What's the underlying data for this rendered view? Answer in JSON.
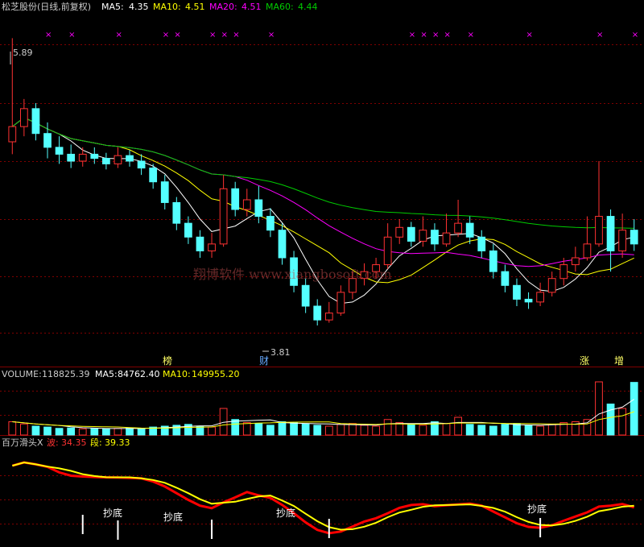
{
  "header": {
    "title": "松芝股份(日线,前复权)",
    "ma5_label": "MA5:",
    "ma5_value": "4.35",
    "ma10_label": "MA10:",
    "ma10_value": "4.51",
    "ma20_label": "MA20:",
    "ma20_value": "4.51",
    "ma60_label": "MA60:",
    "ma60_value": "4.44"
  },
  "price_panel": {
    "high_label": "5.89",
    "low_label": "3.81",
    "watermark": "翔博软件 www.xiangbosoft.com",
    "markers": [
      "榜",
      "财",
      "涨",
      "增"
    ]
  },
  "volume_panel": {
    "volume_label": "VOLUME:",
    "volume_value": "118825.39",
    "ma5_label": "MA5:",
    "ma5_value": "84762.40",
    "ma10_label": "MA10:",
    "ma10_value": "149955.20"
  },
  "indicator_panel": {
    "name": "百万滑头X",
    "wave_label": "波:",
    "wave_value": "34.35",
    "segment_label": "段:",
    "segment_value": "39.33",
    "signal_text": "抄底"
  },
  "colors": {
    "up": "#ff3232",
    "down": "#54ffff",
    "ma5": "#ffffff",
    "ma10": "#ffff00",
    "ma20": "#ff00ff",
    "ma60": "#00cc00",
    "grid": "#800000",
    "wave": "#ff0000",
    "segment": "#ffff00"
  },
  "chart_data": [
    {
      "type": "candlestick",
      "title": "松芝股份(日线,前复权)",
      "y_range": [
        3.81,
        5.89
      ],
      "series": [
        {
          "name": "MA5",
          "last": 4.35
        },
        {
          "name": "MA10",
          "last": 4.51
        },
        {
          "name": "MA20",
          "last": 4.51
        },
        {
          "name": "MA60",
          "last": 4.44
        }
      ],
      "candles": [
        [
          5.14,
          5.25,
          5.89,
          5.05
        ],
        [
          5.25,
          5.38,
          5.45,
          5.18
        ],
        [
          5.38,
          5.2,
          5.42,
          5.15
        ],
        [
          5.2,
          5.1,
          5.28,
          5.02
        ],
        [
          5.1,
          5.05,
          5.18,
          4.98
        ],
        [
          5.05,
          5.0,
          5.12,
          4.95
        ],
        [
          5.0,
          5.05,
          5.1,
          4.96
        ],
        [
          5.05,
          5.02,
          5.1,
          4.98
        ],
        [
          5.02,
          4.98,
          5.06,
          4.94
        ],
        [
          4.98,
          5.04,
          5.1,
          4.95
        ],
        [
          5.04,
          5.0,
          5.08,
          4.96
        ],
        [
          5.0,
          4.95,
          5.05,
          4.9
        ],
        [
          4.95,
          4.85,
          4.98,
          4.8
        ],
        [
          4.85,
          4.7,
          4.9,
          4.65
        ],
        [
          4.7,
          4.55,
          4.74,
          4.5
        ],
        [
          4.55,
          4.45,
          4.6,
          4.4
        ],
        [
          4.45,
          4.35,
          4.5,
          4.3
        ],
        [
          4.35,
          4.4,
          4.48,
          4.3
        ],
        [
          4.4,
          4.8,
          4.9,
          4.38
        ],
        [
          4.8,
          4.65,
          4.85,
          4.6
        ],
        [
          4.65,
          4.72,
          4.8,
          4.6
        ],
        [
          4.72,
          4.6,
          4.82,
          4.55
        ],
        [
          4.6,
          4.5,
          4.66,
          4.45
        ],
        [
          4.5,
          4.3,
          4.55,
          4.25
        ],
        [
          4.3,
          4.1,
          4.35,
          4.05
        ],
        [
          4.1,
          3.95,
          4.15,
          3.9
        ],
        [
          3.95,
          3.85,
          4.0,
          3.81
        ],
        [
          3.85,
          3.9,
          3.98,
          3.83
        ],
        [
          3.9,
          4.05,
          4.1,
          3.88
        ],
        [
          4.05,
          4.15,
          4.2,
          4.0
        ],
        [
          4.15,
          4.2,
          4.26,
          4.1
        ],
        [
          4.2,
          4.25,
          4.3,
          4.15
        ],
        [
          4.25,
          4.45,
          4.55,
          4.22
        ],
        [
          4.45,
          4.52,
          4.58,
          4.4
        ],
        [
          4.52,
          4.42,
          4.56,
          4.38
        ],
        [
          4.42,
          4.5,
          4.6,
          4.38
        ],
        [
          4.5,
          4.4,
          4.55,
          4.35
        ],
        [
          4.4,
          4.48,
          4.62,
          4.38
        ],
        [
          4.48,
          4.55,
          4.72,
          4.45
        ],
        [
          4.55,
          4.45,
          4.6,
          4.4
        ],
        [
          4.45,
          4.35,
          4.5,
          4.3
        ],
        [
          4.35,
          4.2,
          4.4,
          4.15
        ],
        [
          4.2,
          4.1,
          4.25,
          4.05
        ],
        [
          4.1,
          4.0,
          4.15,
          3.95
        ],
        [
          4.0,
          3.98,
          4.05,
          3.93
        ],
        [
          3.98,
          4.05,
          4.12,
          3.95
        ],
        [
          4.05,
          4.15,
          4.2,
          4.02
        ],
        [
          4.15,
          4.25,
          4.3,
          4.1
        ],
        [
          4.25,
          4.3,
          4.38,
          4.2
        ],
        [
          4.3,
          4.4,
          4.6,
          4.28
        ],
        [
          4.4,
          4.6,
          5.0,
          4.38
        ],
        [
          4.6,
          4.35,
          4.65,
          4.2
        ],
        [
          4.35,
          4.5,
          4.62,
          4.3
        ],
        [
          4.5,
          4.4,
          4.58,
          4.35
        ]
      ]
    },
    {
      "type": "bar",
      "title": "VOLUME",
      "series": [
        {
          "name": "VOLUME",
          "last": 118825.39
        },
        {
          "name": "MA5",
          "last": 84762.4
        },
        {
          "name": "MA10",
          "last": 149955.2
        }
      ],
      "values": [
        30,
        25,
        20,
        18,
        15,
        16,
        14,
        15,
        14,
        15,
        16,
        14,
        18,
        20,
        22,
        24,
        20,
        18,
        60,
        35,
        28,
        26,
        22,
        30,
        28,
        25,
        22,
        20,
        24,
        26,
        22,
        20,
        35,
        28,
        24,
        22,
        30,
        26,
        40,
        24,
        22,
        20,
        24,
        26,
        22,
        20,
        24,
        28,
        30,
        35,
        120,
        70,
        60,
        118.8
      ]
    },
    {
      "type": "line",
      "title": "百万滑头X",
      "series": [
        {
          "name": "波",
          "last": 34.35
        },
        {
          "name": "段",
          "last": 39.33
        }
      ]
    }
  ]
}
